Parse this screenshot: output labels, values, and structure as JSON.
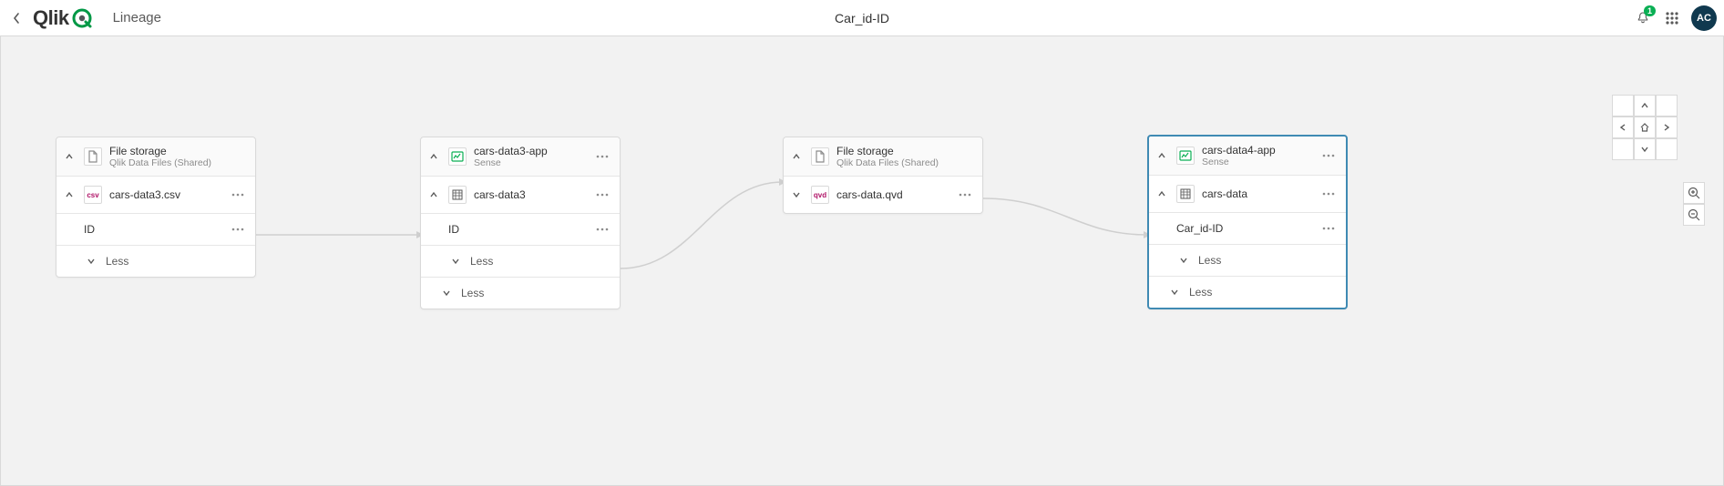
{
  "header": {
    "page_label": "Lineage",
    "center_title": "Car_id-ID",
    "notification_count": "1",
    "avatar_initials": "AC"
  },
  "nodes": {
    "n1": {
      "title": "File storage",
      "subtitle": "Qlik Data Files (Shared)",
      "child_label": "cars-data3.csv",
      "field_label": "ID",
      "less_label": "Less"
    },
    "n2": {
      "title": "cars-data3-app",
      "subtitle": "Sense",
      "child_label": "cars-data3",
      "field_label": "ID",
      "less_label": "Less",
      "less_label2": "Less"
    },
    "n3": {
      "title": "File storage",
      "subtitle": "Qlik Data Files (Shared)",
      "child_label": "cars-data.qvd"
    },
    "n4": {
      "title": "cars-data4-app",
      "subtitle": "Sense",
      "child_label": "cars-data",
      "field_label": "Car_id-ID",
      "less_label": "Less",
      "less_label2": "Less"
    }
  }
}
